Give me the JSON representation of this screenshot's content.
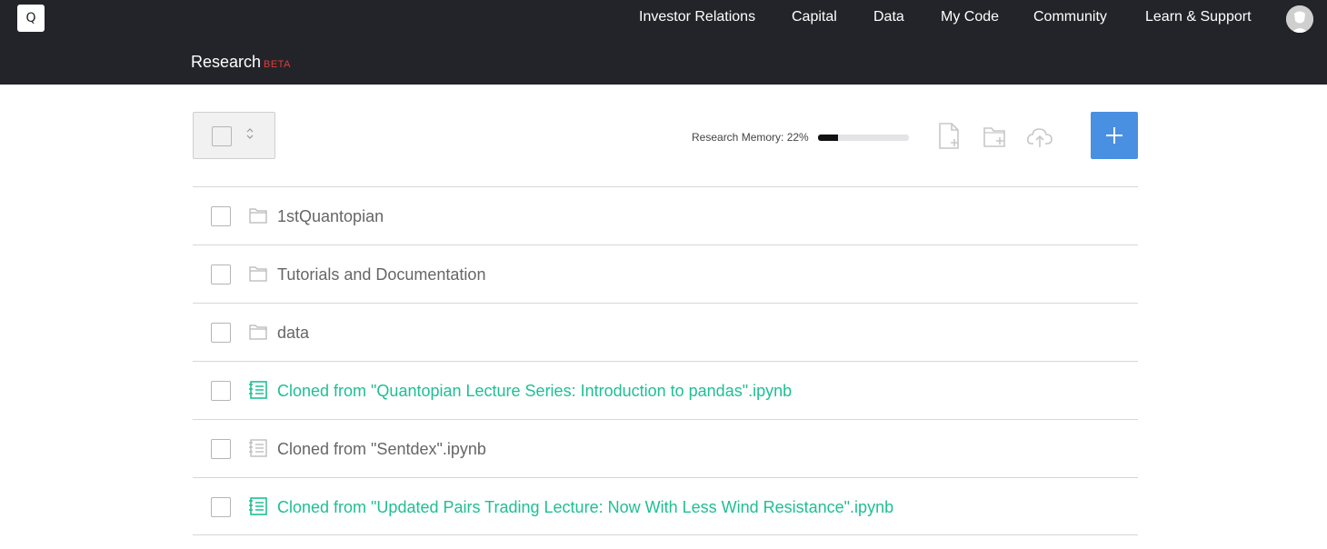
{
  "header": {
    "logo_text": "Q",
    "nav": [
      "Investor Relations",
      "Capital",
      "Data",
      "My Code",
      "Community",
      "Learn & Support"
    ],
    "section_title": "Research",
    "section_badge": "BETA"
  },
  "toolbar": {
    "memory_label": "Research Memory: 22%",
    "memory_percent": 22,
    "icons": [
      "new-file-icon",
      "new-folder-icon",
      "upload-cloud-icon"
    ],
    "add_button_icon": "plus-icon",
    "colors": {
      "add_button": "#4a90e2",
      "memory_fill": "#111111"
    }
  },
  "files": [
    {
      "name": "1stQuantopian",
      "type": "folder"
    },
    {
      "name": "Tutorials and Documentation",
      "type": "folder"
    },
    {
      "name": "data",
      "type": "folder"
    },
    {
      "name": "Cloned from \"Quantopian Lecture Series: Introduction to pandas\".ipynb",
      "type": "notebook",
      "running": true
    },
    {
      "name": "Cloned from \"Sentdex\".ipynb",
      "type": "notebook",
      "running": false
    },
    {
      "name": "Cloned from \"Updated Pairs Trading Lecture: Now With Less Wind Resistance\".ipynb",
      "type": "notebook",
      "running": true
    }
  ],
  "colors": {
    "header_bg": "#232429",
    "beta": "#e23b3b",
    "running_notebook": "#1fbf93"
  }
}
